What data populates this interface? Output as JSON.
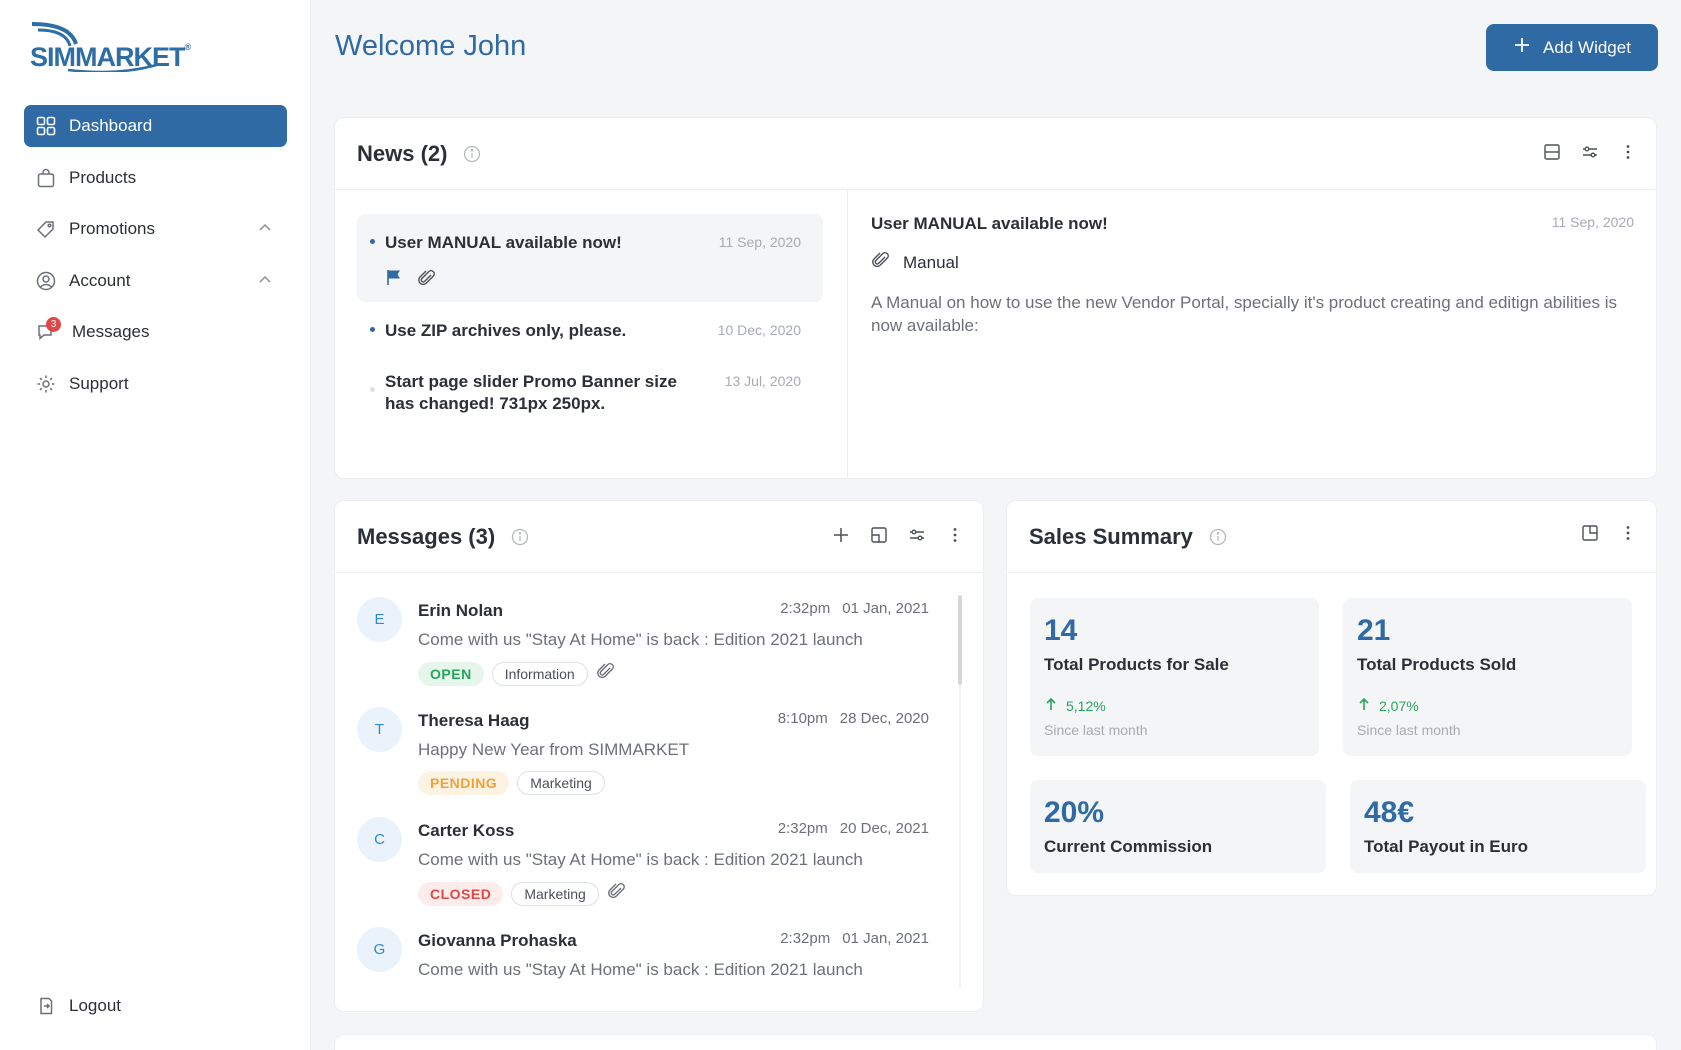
{
  "brand": {
    "name": "SIMMARKET",
    "mark": "®"
  },
  "header": {
    "welcome": "Welcome John",
    "add_widget": "Add Widget"
  },
  "sidebar": {
    "items": [
      {
        "label": "Dashboard",
        "icon": "grid-icon",
        "active": true
      },
      {
        "label": "Products",
        "icon": "shopping-bag-icon"
      },
      {
        "label": "Promotions",
        "icon": "tag-icon",
        "expanded": true
      },
      {
        "label": "Account",
        "icon": "user-circle-icon",
        "expanded": true
      },
      {
        "label": "Messages",
        "icon": "chat-icon",
        "badge": "3"
      },
      {
        "label": "Support",
        "icon": "gear-icon"
      }
    ],
    "logout": "Logout"
  },
  "news": {
    "title": "News (2)",
    "items": [
      {
        "title": "User MANUAL available now!",
        "date": "11 Sep, 2020"
      },
      {
        "title": "Use ZIP archives only, please.",
        "date": "10 Dec, 2020"
      },
      {
        "title": "Start page slider Promo Banner size has changed! 731px 250px.",
        "date": "13 Jul, 2020"
      }
    ],
    "detail": {
      "title": "User MANUAL available now!",
      "date": "11 Sep, 2020",
      "attachment": "Manual",
      "body": "A Manual on how to use the new Vendor Portal, specially it's product creating and editign abilities is now available:"
    }
  },
  "messages": {
    "title": "Messages (3)",
    "items": [
      {
        "initial": "E",
        "name": "Erin Nolan",
        "time": "2:32pm",
        "date": "01 Jan, 2021",
        "text": "Come with us \"Stay At Home\" is back : Edition 2021 launch",
        "status": "OPEN",
        "label": "Information"
      },
      {
        "initial": "T",
        "name": "Theresa Haag",
        "time": "8:10pm",
        "date": "28 Dec, 2020",
        "text": "Happy New Year from SIMMARKET",
        "status": "PENDING",
        "label": "Marketing"
      },
      {
        "initial": "C",
        "name": "Carter Koss",
        "time": "2:32pm",
        "date": "20 Dec, 2021",
        "text": "Come with us \"Stay At Home\" is back : Edition 2021 launch",
        "status": "CLOSED",
        "label": "Marketing"
      },
      {
        "initial": "G",
        "name": "Giovanna Prohaska",
        "time": "2:32pm",
        "date": "01 Jan, 2021",
        "text": "Come with us \"Stay At Home\" is back : Edition 2021 launch"
      }
    ]
  },
  "sales": {
    "title": "Sales Summary",
    "stats": [
      {
        "value": "14",
        "label": "Total Products for Sale",
        "trend": "5,12%",
        "since": "Since last month"
      },
      {
        "value": "21",
        "label": "Total Products Sold",
        "trend": "2,07%",
        "since": "Since last month"
      },
      {
        "value": "20%",
        "label": "Current Commission"
      },
      {
        "value": "48€",
        "label": "Total Payout in Euro"
      }
    ]
  },
  "colors": {
    "accent": "#2f6aa5",
    "open": "#26a65b",
    "pending": "#f0a13a",
    "closed": "#e04848"
  }
}
